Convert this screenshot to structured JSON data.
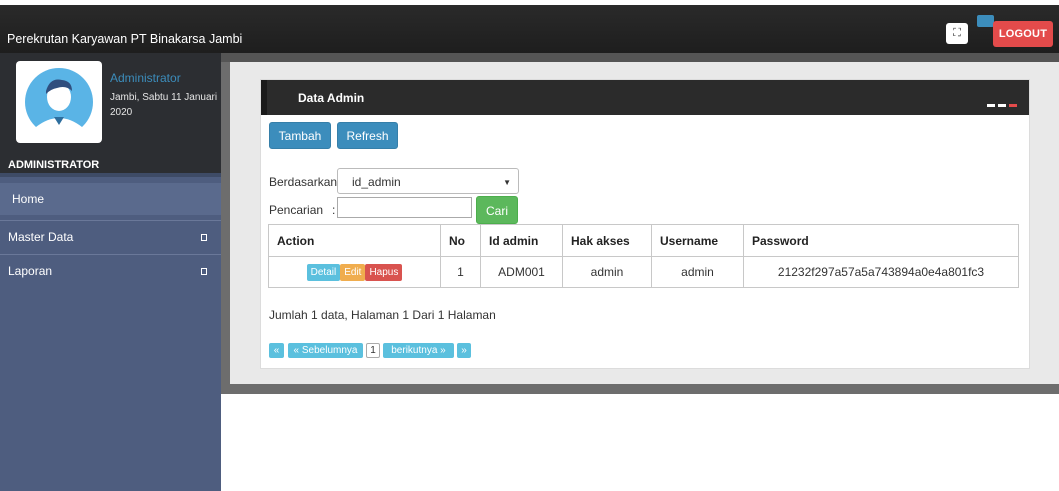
{
  "header": {
    "brand": "Perekrutan Karyawan PT Binakarsa Jambi",
    "expand_icon": "⛶",
    "logout_label": "LOGOUT"
  },
  "sidebar": {
    "user_name": "Administrator",
    "user_date": "Jambi, Sabtu 11 Januari 2020",
    "section_header": "ADMINISTRATOR",
    "items": [
      {
        "label": "Home"
      },
      {
        "label": "Master Data"
      },
      {
        "label": "Laporan"
      }
    ]
  },
  "panel": {
    "title": "Data Admin",
    "tambah_label": "Tambah",
    "refresh_label": "Refresh",
    "berdasarkan_label": "Berdasarkan:",
    "select_value": "id_admin",
    "pencarian_label": "Pencarian",
    "pencarian_colon": ":",
    "cari_label": "Cari"
  },
  "table": {
    "columns": [
      "Action",
      "No",
      "Id admin",
      "Hak akses",
      "Username",
      "Password"
    ],
    "rows": [
      {
        "actions": [
          "Detail",
          "Edit",
          "Hapus"
        ],
        "no": "1",
        "id_admin": "ADM001",
        "hak_akses": "admin",
        "username": "admin",
        "password": "21232f297a57a5a743894a0e4a801fc3"
      }
    ]
  },
  "footer": {
    "summary": "Jumlah 1 data, Halaman 1 Dari 1 Halaman",
    "pager": [
      "«",
      "« Sebelumnya",
      "1",
      "berikutnya »",
      "»"
    ]
  },
  "colors": {
    "topbar": "#1e1e1e",
    "sidebar": "#4e5d7f",
    "primary": "#3c8dbc",
    "success": "#5cb85c",
    "danger": "#e34b4b"
  }
}
